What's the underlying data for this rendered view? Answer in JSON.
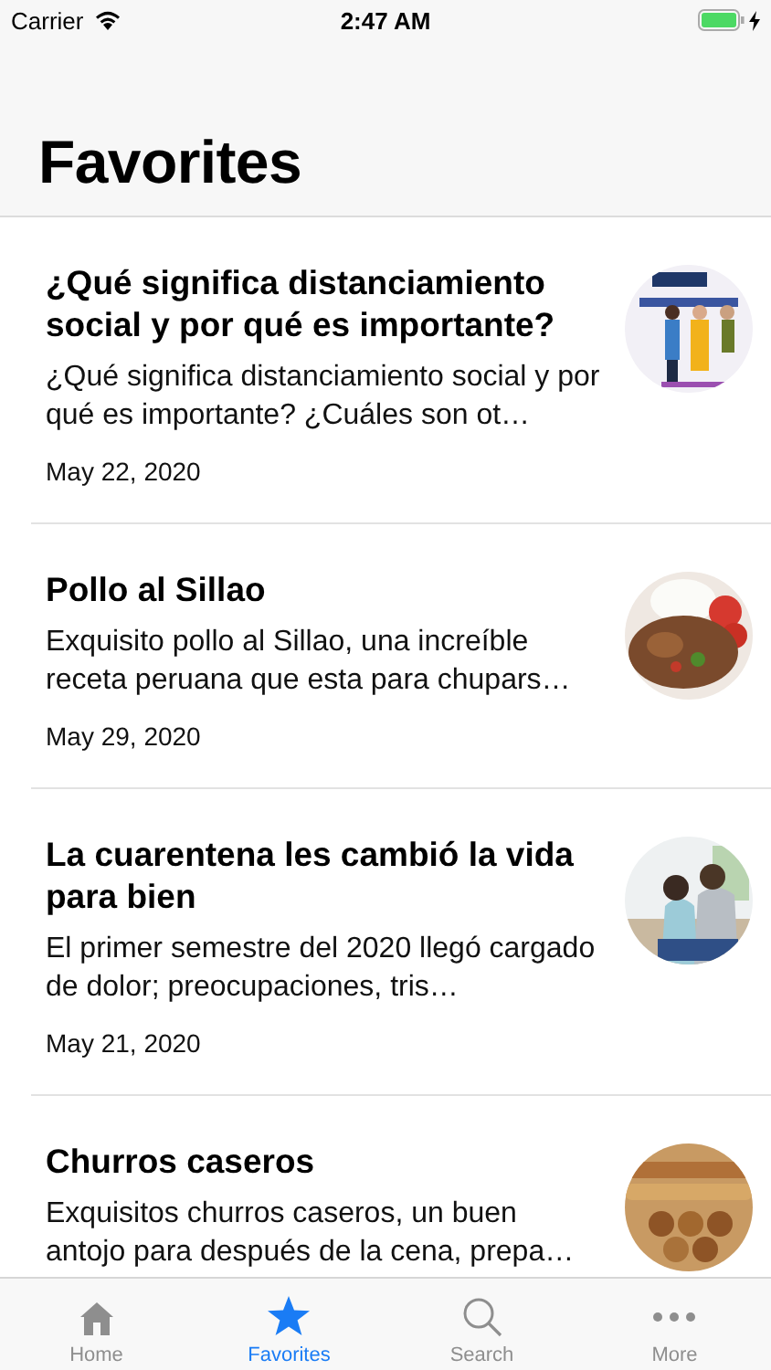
{
  "status_bar": {
    "carrier": "Carrier",
    "time": "2:47 AM",
    "charging": true
  },
  "title": "Favorites",
  "articles": [
    {
      "title": "¿Qué significa distanciamiento social y por qué es importante?",
      "summary": "¿Qué significa distanciamiento social y por qué es importante? ¿Cuáles son ot…",
      "date": "May 22, 2020"
    },
    {
      "title": "Pollo al Sillao",
      "summary": "Exquisito pollo al Sillao, una increíble receta peruana que esta para chupars…",
      "date": "May 29, 2020"
    },
    {
      "title": "La cuarentena les cambió la vida para bien",
      "summary": "El primer semestre del 2020 llegó cargado de dolor; preocupaciones, tris…",
      "date": "May 21, 2020"
    },
    {
      "title": "Churros caseros",
      "summary": "Exquisitos churros caseros, un buen antojo para después de la cena, prepa…"
    }
  ],
  "tabs": [
    {
      "label": "Home",
      "kind": "home",
      "selected": false
    },
    {
      "label": "Favorites",
      "kind": "star",
      "selected": true
    },
    {
      "label": "Search",
      "kind": "search",
      "selected": false
    },
    {
      "label": "More",
      "kind": "more",
      "selected": false
    }
  ]
}
